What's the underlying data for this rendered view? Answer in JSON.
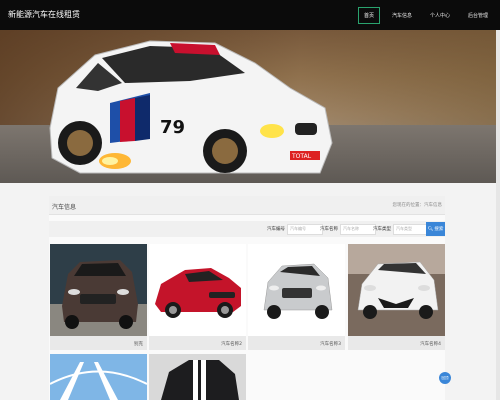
{
  "header": {
    "brand": "新能源汽车在线租赁",
    "nav": [
      {
        "label": "首页",
        "active": true
      },
      {
        "label": "汽车信息",
        "active": false
      },
      {
        "label": "个人中心",
        "active": false
      },
      {
        "label": "后台管理",
        "active": false
      }
    ]
  },
  "section": {
    "title": "汽车信息",
    "breadcrumb": "您现在的位置：汽车信息"
  },
  "search": {
    "fields": [
      {
        "label": "汽车编号",
        "placeholder": "汽车编号"
      },
      {
        "label": "汽车名称",
        "placeholder": "汽车名称"
      },
      {
        "label": "汽车类型",
        "placeholder": "汽车类型"
      }
    ],
    "button_label": "搜索"
  },
  "cards": [
    {
      "caption": "别克"
    },
    {
      "caption": "汽车名称2"
    },
    {
      "caption": "汽车名称3"
    },
    {
      "caption": "汽车名称4"
    }
  ],
  "floating_button": "回顶"
}
